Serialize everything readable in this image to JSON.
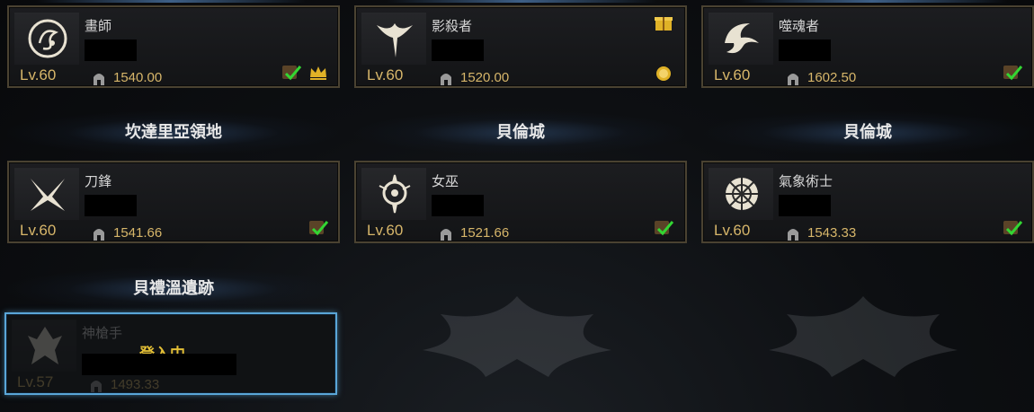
{
  "colors": {
    "gold": "#d7b66a",
    "border": "#4a4231",
    "selected": "#5aa6d8",
    "check": "#33d633",
    "login": "#e3bf36"
  },
  "characters": [
    {
      "class": "畫師",
      "level": "Lv.60",
      "item_level": "1540.00",
      "icon": "painter-class-icon",
      "badges": [
        "roster-check-icon",
        "crown-icon"
      ]
    },
    {
      "class": "影殺者",
      "level": "Lv.60",
      "item_level": "1520.00",
      "icon": "shadowhunter-class-icon",
      "badges": [
        "gift-icon",
        "coin-icon"
      ]
    },
    {
      "class": "噬魂者",
      "level": "Lv.60",
      "item_level": "1602.50",
      "icon": "souleater-class-icon",
      "badges": [
        "roster-check-icon"
      ]
    },
    {
      "class": "刀鋒",
      "level": "Lv.60",
      "item_level": "1541.66",
      "icon": "deathblade-class-icon",
      "badges": [
        "roster-check-icon"
      ]
    },
    {
      "class": "女巫",
      "level": "Lv.60",
      "item_level": "1521.66",
      "icon": "sorceress-class-icon",
      "badges": [
        "roster-check-icon"
      ]
    },
    {
      "class": "氣象術士",
      "level": "Lv.60",
      "item_level": "1543.33",
      "icon": "aeromancer-class-icon",
      "badges": [
        "roster-check-icon"
      ]
    },
    {
      "class": "神槍手",
      "level": "Lv.57",
      "item_level": "1493.33",
      "icon": "sharpshooter-class-icon",
      "status": "登入中"
    }
  ],
  "regions": [
    "坎達里亞領地",
    "貝倫城",
    "貝倫城",
    "貝禮溫遺跡"
  ]
}
